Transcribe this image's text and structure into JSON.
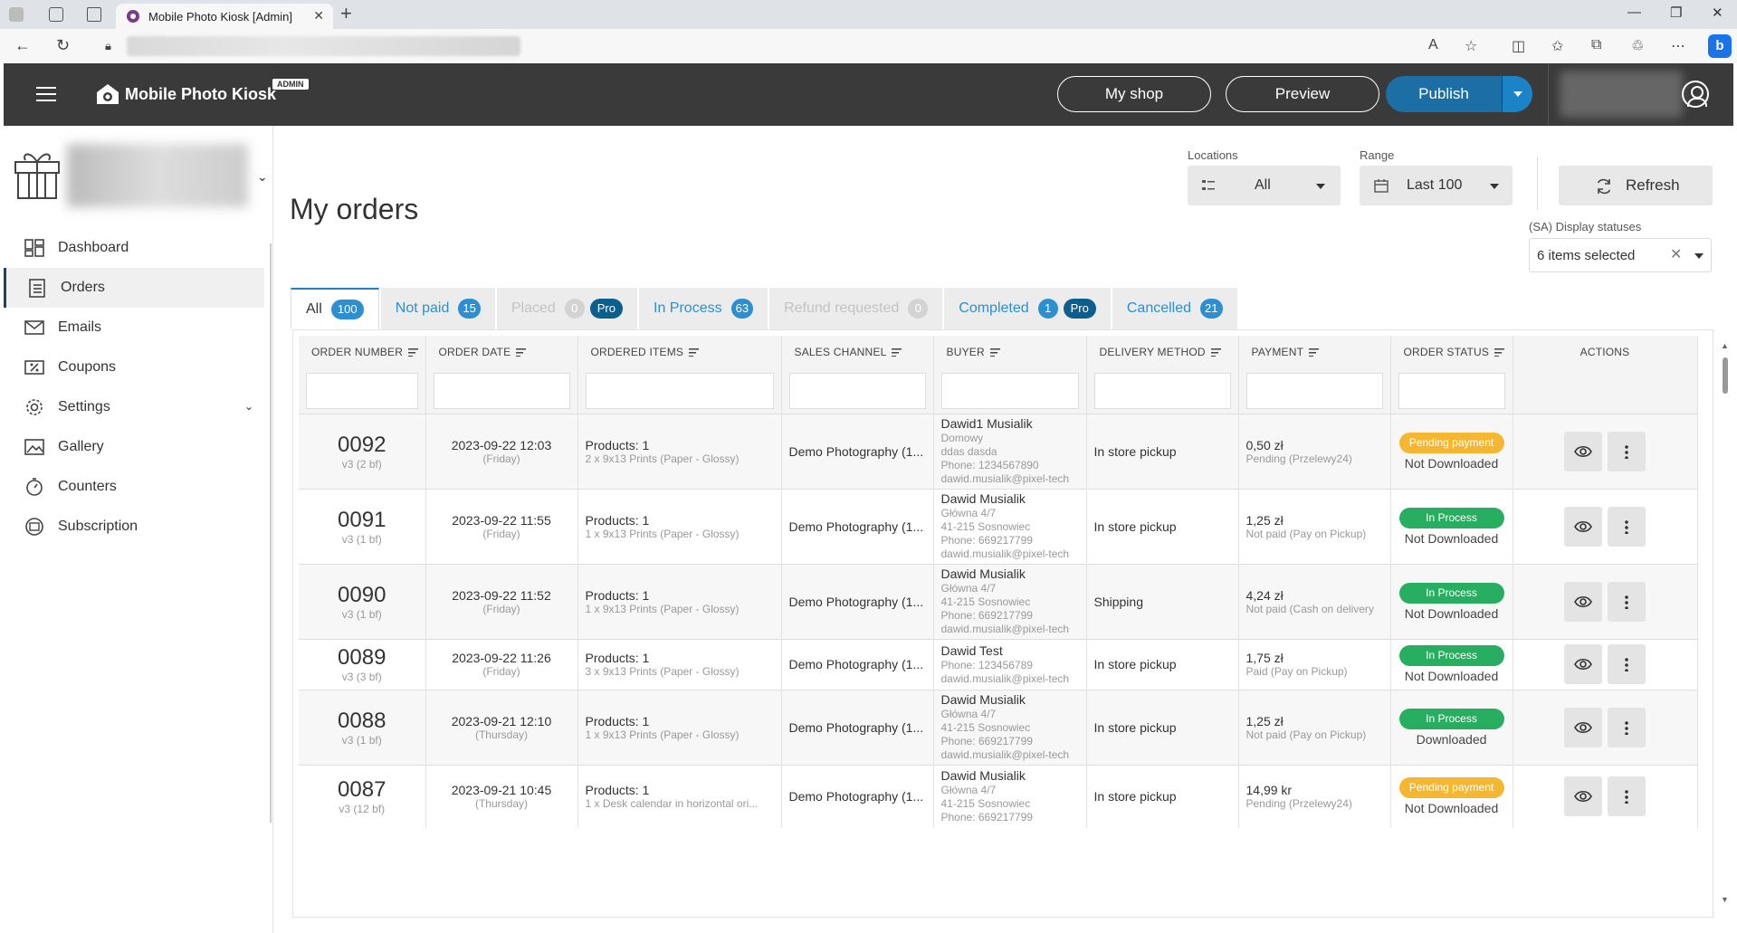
{
  "browser": {
    "tab_title": "Mobile Photo Kiosk [Admin]",
    "tab_close": "✕",
    "new_tab": "+"
  },
  "header": {
    "brand": "Mobile Photo Kiosk",
    "badge": "ADMIN",
    "my_shop": "My shop",
    "preview": "Preview",
    "publish": "Publish"
  },
  "sidebar": {
    "items": [
      {
        "label": "Dashboard",
        "icon": "dashboard-icon"
      },
      {
        "label": "Orders",
        "icon": "orders-icon",
        "active": true
      },
      {
        "label": "Emails",
        "icon": "email-icon"
      },
      {
        "label": "Coupons",
        "icon": "coupon-icon"
      },
      {
        "label": "Settings",
        "icon": "gear-icon",
        "expandable": true
      },
      {
        "label": "Gallery",
        "icon": "gallery-icon"
      },
      {
        "label": "Counters",
        "icon": "counter-icon"
      },
      {
        "label": "Subscription",
        "icon": "subscription-icon"
      }
    ]
  },
  "page": {
    "title": "My orders",
    "locations_label": "Locations",
    "locations_value": "All",
    "range_label": "Range",
    "range_value": "Last 100",
    "refresh": "Refresh",
    "statuses_label": "(SA) Display statuses",
    "statuses_value": "6 items selected"
  },
  "tabs": [
    {
      "label": "All",
      "count": "100",
      "state": "active"
    },
    {
      "label": "Not paid",
      "count": "15",
      "state": "normal"
    },
    {
      "label": "Placed",
      "count": "0",
      "state": "disabled",
      "pro": "Pro"
    },
    {
      "label": "In Process",
      "count": "63",
      "state": "normal"
    },
    {
      "label": "Refund requested",
      "count": "0",
      "state": "disabled"
    },
    {
      "label": "Completed",
      "count": "1",
      "state": "normal",
      "pro": "Pro"
    },
    {
      "label": "Cancelled",
      "count": "21",
      "state": "normal"
    }
  ],
  "columns": [
    "ORDER NUMBER",
    "ORDER DATE",
    "ORDERED ITEMS",
    "SALES CHANNEL",
    "BUYER",
    "DELIVERY METHOD",
    "PAYMENT",
    "ORDER STATUS",
    "ACTIONS"
  ],
  "orders": [
    {
      "number": "0092",
      "version": "v3 (2 bf)",
      "date": "2023-09-22 12:03",
      "day": "(Friday)",
      "products": "Products: 1",
      "items": "2 x 9x13 Prints (Paper - Glossy)",
      "channel": "Demo Photography (1...",
      "buyer": [
        "Dawid1 Musialik",
        "Domowy",
        "ddas dasda",
        "Phone: 1234567890",
        "dawid.musialik@pixel-tech"
      ],
      "delivery": "In store pickup",
      "amount": "0,50 zł",
      "pay_status": "Pending (Przelewy24)",
      "status": "Pending payment",
      "status_color": "yellow",
      "download": "Not Downloaded"
    },
    {
      "number": "0091",
      "version": "v3 (1 bf)",
      "date": "2023-09-22 11:55",
      "day": "(Friday)",
      "products": "Products: 1",
      "items": "1 x 9x13 Prints (Paper - Glossy)",
      "channel": "Demo Photography (1...",
      "buyer": [
        "Dawid Musialik",
        "Główna 4/7",
        "41-215 Sosnowiec",
        "Phone: 669217799",
        "dawid.musialik@pixel-tech"
      ],
      "delivery": "In store pickup",
      "amount": "1,25 zł",
      "pay_status": "Not paid (Pay on Pickup)",
      "status": "In Process",
      "status_color": "green",
      "download": "Not Downloaded"
    },
    {
      "number": "0090",
      "version": "v3 (1 bf)",
      "date": "2023-09-22 11:52",
      "day": "(Friday)",
      "products": "Products: 1",
      "items": "1 x 9x13 Prints (Paper - Glossy)",
      "channel": "Demo Photography (1...",
      "buyer": [
        "Dawid Musialik",
        "Główna 4/7",
        "41-215 Sosnowiec",
        "Phone: 669217799",
        "dawid.musialik@pixel-tech"
      ],
      "delivery": "Shipping",
      "amount": "4,24 zł",
      "pay_status": "Not paid (Cash on delivery",
      "status": "In Process",
      "status_color": "green",
      "download": "Not Downloaded"
    },
    {
      "number": "0089",
      "version": "v3 (3 bf)",
      "date": "2023-09-22 11:26",
      "day": "(Friday)",
      "products": "Products: 1",
      "items": "3 x 9x13 Prints (Paper - Glossy)",
      "channel": "Demo Photography (1...",
      "buyer": [
        "Dawid Test",
        "Phone: 123456789",
        "dawid.musialik@pixel-tech"
      ],
      "delivery": "In store pickup",
      "amount": "1,75 zł",
      "pay_status": "Paid (Pay on Pickup)",
      "status": "In Process",
      "status_color": "green",
      "download": "Not Downloaded"
    },
    {
      "number": "0088",
      "version": "v3 (1 bf)",
      "date": "2023-09-21 12:10",
      "day": "(Thursday)",
      "products": "Products: 1",
      "items": "1 x 9x13 Prints (Paper - Glossy)",
      "channel": "Demo Photography (1...",
      "buyer": [
        "Dawid Musialik",
        "Główna 4/7",
        "41-215 Sosnowiec",
        "Phone: 669217799",
        "dawid.musialik@pixel-tech"
      ],
      "delivery": "In store pickup",
      "amount": "1,25 zł",
      "pay_status": "Not paid (Pay on Pickup)",
      "status": "In Process",
      "status_color": "green",
      "download": "Downloaded"
    },
    {
      "number": "0087",
      "version": "v3 (12 bf)",
      "date": "2023-09-21 10:45",
      "day": "(Thursday)",
      "products": "Products: 1",
      "items": "1 x Desk calendar in horizontal ori...",
      "channel": "Demo Photography (1...",
      "buyer": [
        "Dawid Musialik",
        "Główna 4/7",
        "41-215 Sosnowiec",
        "Phone: 669217799"
      ],
      "delivery": "In store pickup",
      "amount": "14,99 kr",
      "pay_status": "Pending (Przelewy24)",
      "status": "Pending payment",
      "status_color": "yellow",
      "download": "Not Downloaded"
    }
  ]
}
